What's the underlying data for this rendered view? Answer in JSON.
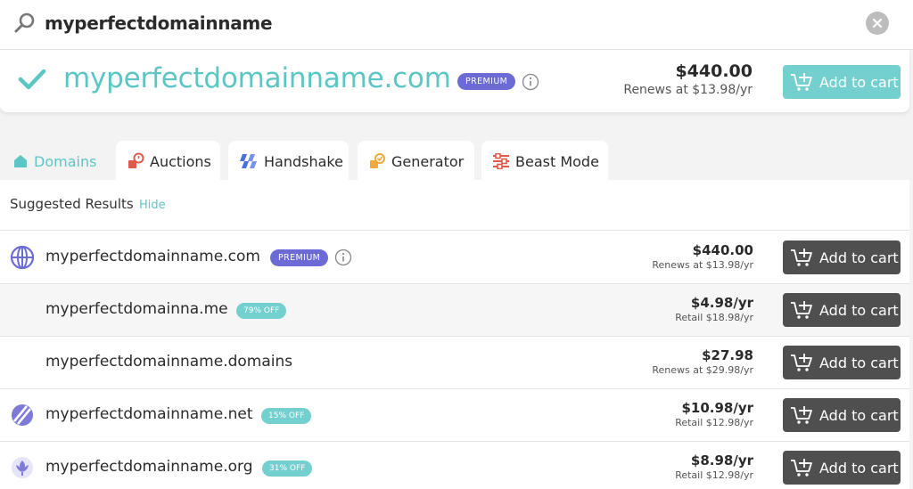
{
  "search": {
    "query": "myperfectdomainname"
  },
  "featured": {
    "domain": "myperfectdomainname.com",
    "badge": "PREMIUM",
    "price": "$440.00",
    "renew": "Renews at $13.98/yr",
    "cart_label": "Add to cart"
  },
  "tabs": [
    {
      "label": "Domains"
    },
    {
      "label": "Auctions"
    },
    {
      "label": "Handshake"
    },
    {
      "label": "Generator"
    },
    {
      "label": "Beast Mode"
    }
  ],
  "results": {
    "title": "Suggested Results",
    "hide_label": "Hide",
    "rows": [
      {
        "domain": "myperfectdomainname.com",
        "badge": "PREMIUM",
        "price": "$440.00",
        "sub": "Renews at $13.98/yr",
        "cart_label": "Add to cart"
      },
      {
        "domain": "myperfectdomainna.me",
        "badge": "79% OFF",
        "price": "$4.98/yr",
        "sub": "Retail $18.98/yr",
        "cart_label": "Add to cart"
      },
      {
        "domain": "myperfectdomainname.domains",
        "badge": "",
        "price": "$27.98",
        "sub": "Renews at $29.98/yr",
        "cart_label": "Add to cart"
      },
      {
        "domain": "myperfectdomainname.net",
        "badge": "15% OFF",
        "price": "$10.98/yr",
        "sub": "Retail $12.98/yr",
        "cart_label": "Add to cart"
      },
      {
        "domain": "myperfectdomainname.org",
        "badge": "31% OFF",
        "price": "$8.98/yr",
        "sub": "Retail $12.98/yr",
        "cart_label": "Add to cart"
      }
    ]
  },
  "colors": {
    "accent": "#5cc6c4",
    "button_teal": "#74cfcf",
    "button_dark": "#4f4f4f",
    "premium": "#6c6bd6"
  },
  "icons": [
    "search-icon",
    "clear-icon",
    "check-icon",
    "info-icon",
    "cart-icon",
    "home-icon",
    "auction-icon",
    "handshake-icon",
    "generator-icon",
    "sliders-icon",
    "globe-icon",
    "net-icon",
    "org-icon"
  ]
}
